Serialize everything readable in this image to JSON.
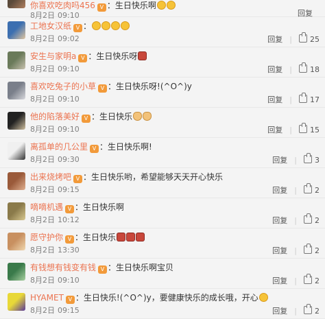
{
  "comments": [
    {
      "user": "你喜欢吃肉吗456",
      "text": "生日快乐啊",
      "emojis": [
        "face",
        "face"
      ],
      "date": "8月2日",
      "time": "09:10",
      "reply": "回复",
      "likes": "",
      "avatar_colors": [
        "#5a4a3a",
        "#b08060"
      ]
    },
    {
      "user": "工地女汉纸",
      "text": "",
      "emojis": [
        "face",
        "face",
        "face",
        "face"
      ],
      "date": "8月2日",
      "time": "09:02",
      "reply": "回复",
      "likes": "25",
      "avatar_colors": [
        "#3c6fb0",
        "#e2c6a0"
      ]
    },
    {
      "user": "安生与家明a",
      "text": "生日快乐呀",
      "emojis": [
        "cake"
      ],
      "date": "8月2日",
      "time": "09:10",
      "reply": "回复",
      "likes": "18",
      "avatar_colors": [
        "#6a7a5a",
        "#c9c2b0"
      ]
    },
    {
      "user": "喜欢吃兔子的小草",
      "text": "生日快乐呀!(^O^)y",
      "emojis": [],
      "date": "8月2日",
      "time": "09:10",
      "reply": "回复",
      "likes": "17",
      "avatar_colors": [
        "#7a7f8a",
        "#d8d8dc"
      ]
    },
    {
      "user": "他的陷落美好",
      "text": "生日快乐",
      "emojis": [
        "hand",
        "hand"
      ],
      "date": "8月2日",
      "time": "09:10",
      "reply": "回复",
      "likes": "15",
      "avatar_colors": [
        "#222222",
        "#d0c0a0"
      ]
    },
    {
      "user": "离孤单的几公里",
      "text": "生日快乐啊!",
      "emojis": [],
      "date": "8月2日",
      "time": "09:30",
      "reply": "回复",
      "likes": "3",
      "avatar_colors": [
        "#f0f0f0",
        "#333333"
      ]
    },
    {
      "user": "出来烧烤吧",
      "text": "生日快乐哟，希望能够天天开心快乐",
      "emojis": [],
      "date": "8月2日",
      "time": "09:15",
      "reply": "回复",
      "likes": "2",
      "avatar_colors": [
        "#9a5a3a",
        "#e0b090"
      ]
    },
    {
      "user": "嘀嘀机遇",
      "text": "生日快乐啊",
      "emojis": [],
      "date": "8月2日",
      "time": "10:12",
      "reply": "回复",
      "likes": "2",
      "avatar_colors": [
        "#8a7a4a",
        "#d8c890"
      ]
    },
    {
      "user": "愿守护你",
      "text": "生日快乐",
      "emojis": [
        "cake",
        "cake",
        "cake"
      ],
      "date": "8月2日",
      "time": "13:30",
      "reply": "回复",
      "likes": "2",
      "avatar_colors": [
        "#c89060",
        "#f0d8b0"
      ]
    },
    {
      "user": "有钱想有钱变有钱",
      "text": "生日快乐啊宝贝",
      "emojis": [],
      "date": "8月2日",
      "time": "09:10",
      "reply": "回复",
      "likes": "2",
      "avatar_colors": [
        "#3a7a4a",
        "#a8d0a0"
      ]
    },
    {
      "user": "HYAMET",
      "text": "生日快乐!(^O^)y，要健康快乐的成长哦，开心",
      "emojis": [
        "face"
      ],
      "date": "8月2日",
      "time": "09:15",
      "reply": "回复",
      "likes": "2",
      "avatar_colors": [
        "#e8d838",
        "#5a3a9a"
      ]
    }
  ]
}
